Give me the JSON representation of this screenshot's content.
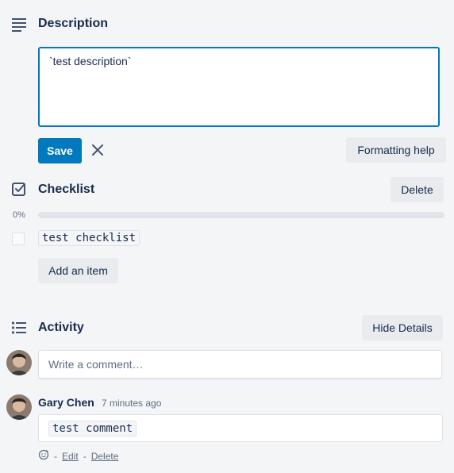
{
  "description": {
    "title": "Description",
    "value": "`test description`",
    "save_label": "Save",
    "formatting_help_label": "Formatting help"
  },
  "checklist": {
    "title": "Checklist",
    "delete_label": "Delete",
    "progress_text": "0%",
    "progress_fraction": 0,
    "items": [
      {
        "text": "test checklist",
        "checked": false
      }
    ],
    "add_item_label": "Add an item"
  },
  "activity": {
    "title": "Activity",
    "hide_details_label": "Hide Details",
    "comment_placeholder": "Write a comment…",
    "comments": [
      {
        "author": "Gary Chen",
        "time": "7 minutes ago",
        "text": "test comment",
        "edit_label": "Edit",
        "delete_label": "Delete",
        "separator": "-"
      }
    ]
  },
  "colors": {
    "accent": "#0079bf",
    "text": "#172b4d",
    "muted": "#5e6c84",
    "background": "#f4f5f7"
  }
}
